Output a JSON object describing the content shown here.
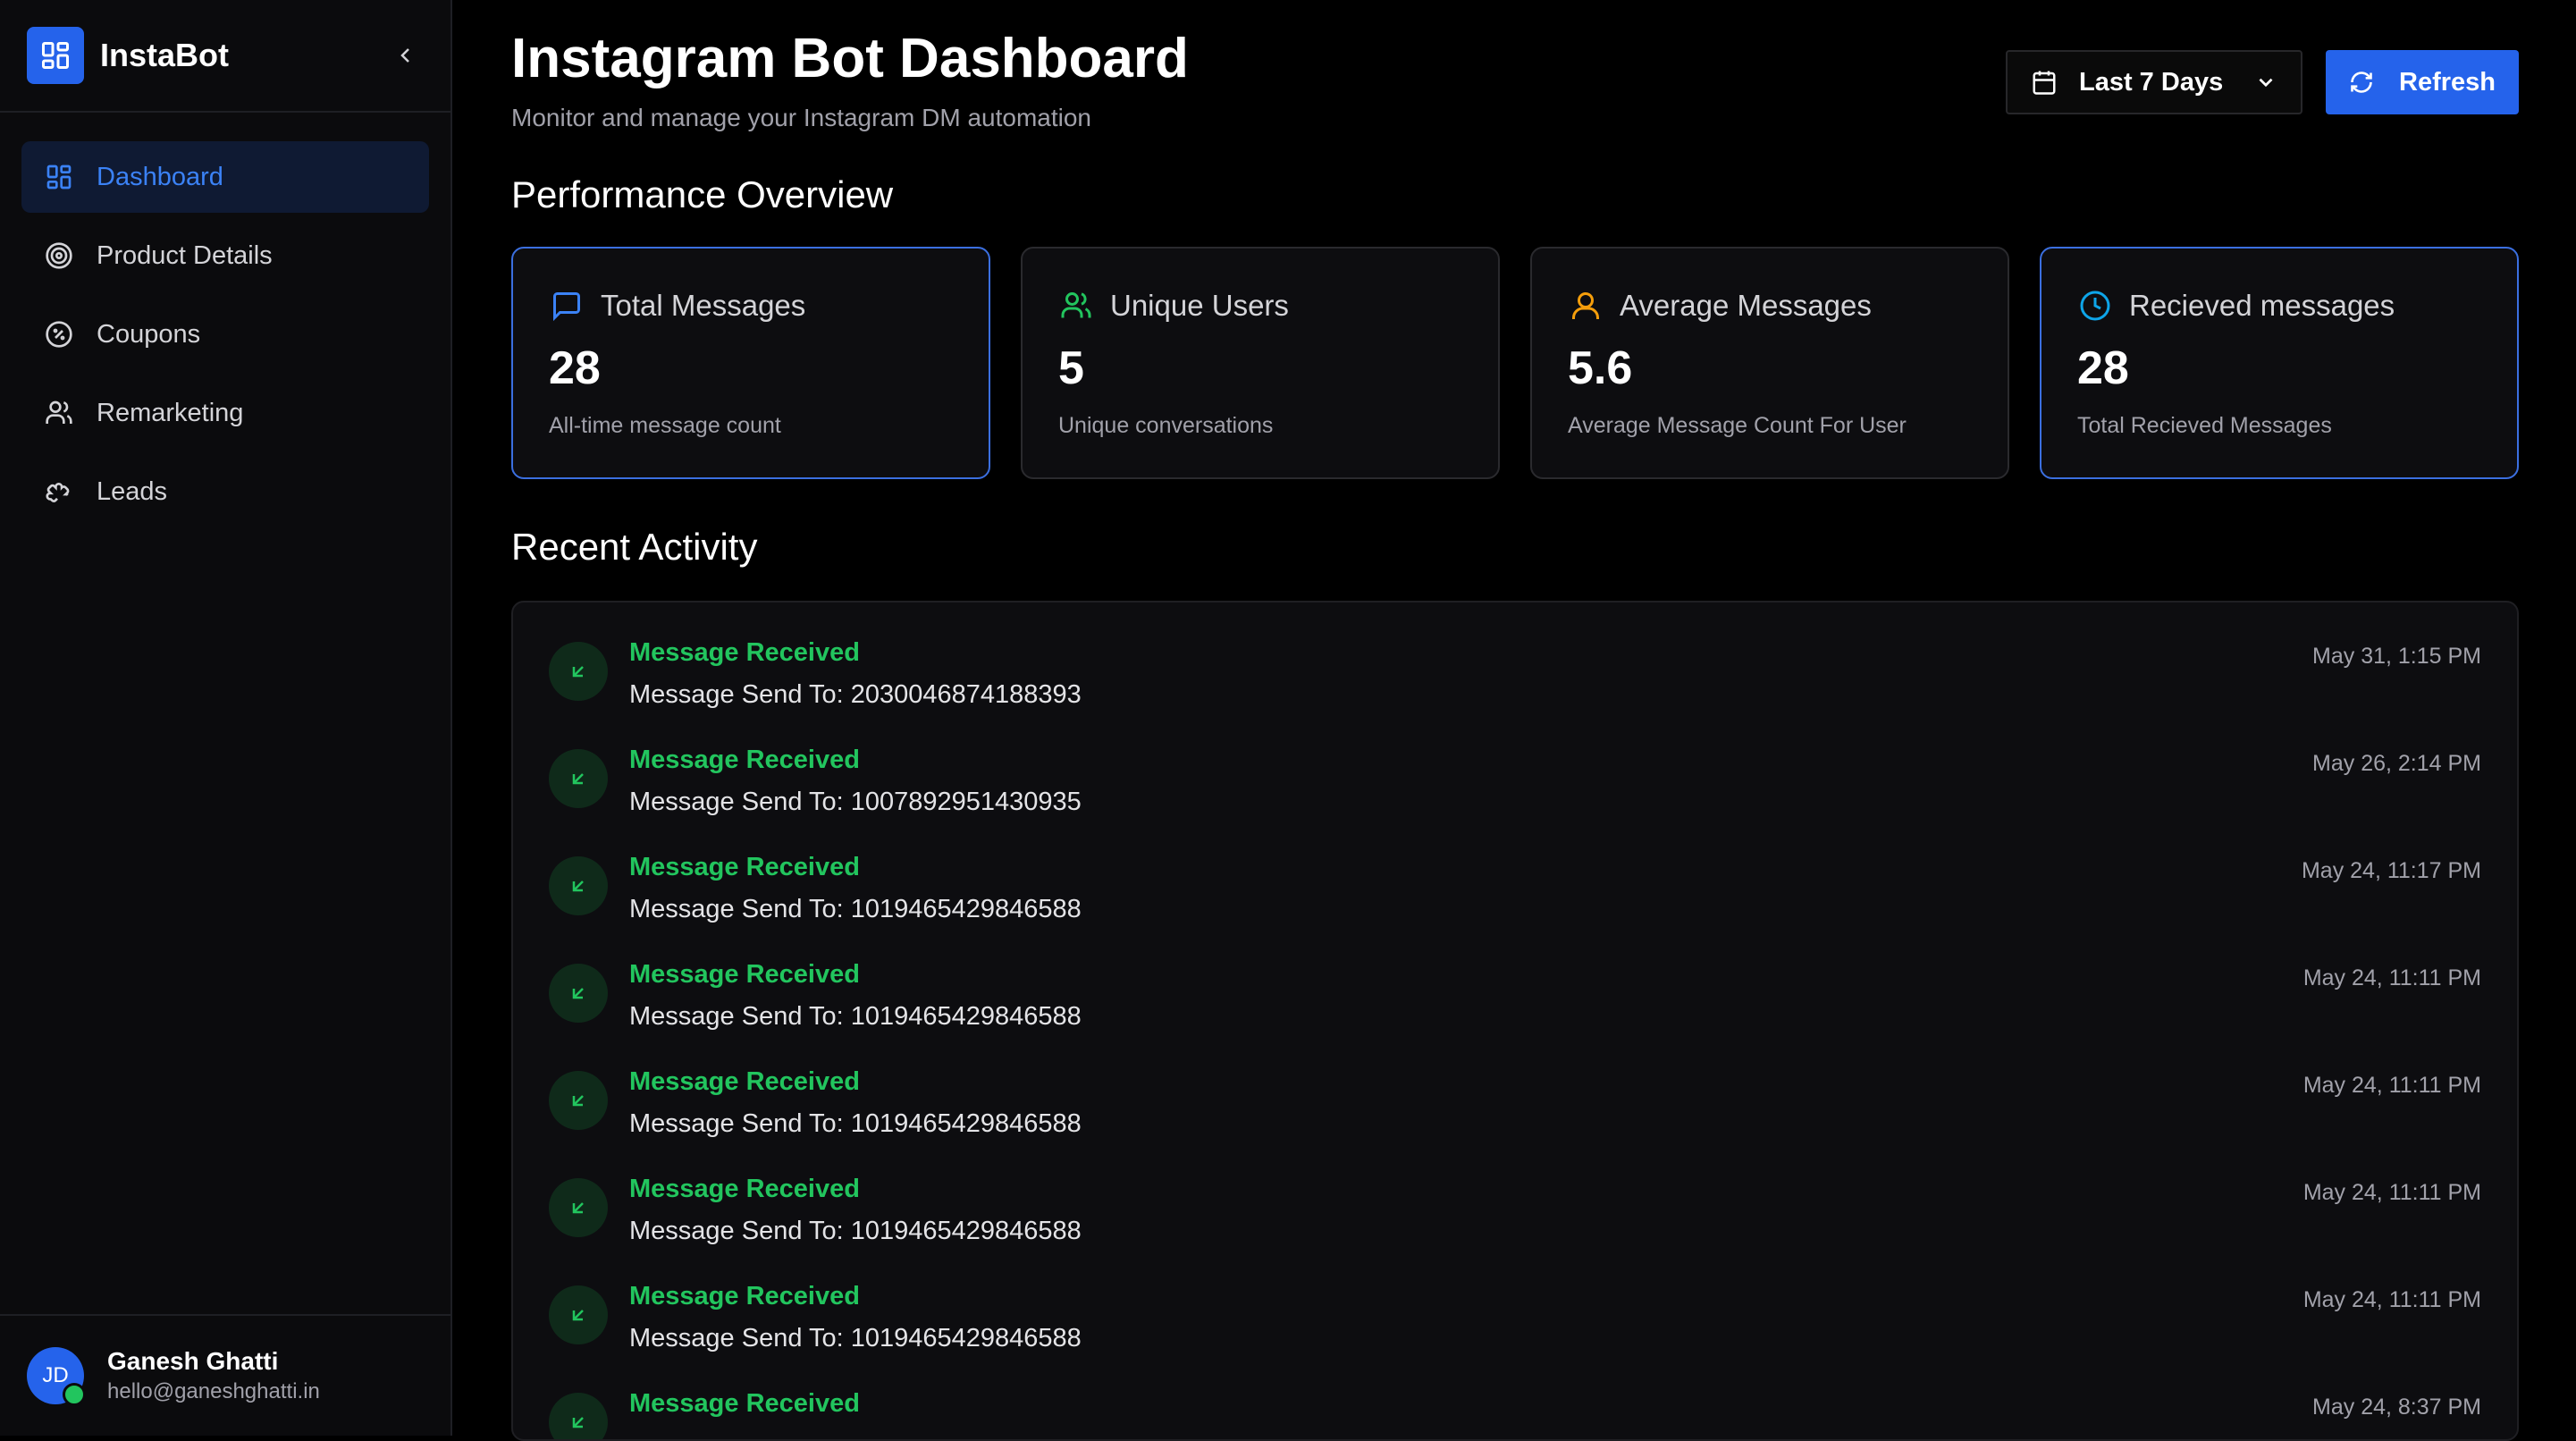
{
  "app": {
    "name": "InstaBot"
  },
  "colors": {
    "accent": "#2563eb",
    "success": "#22c55e",
    "warning": "#f59e0b",
    "info": "#0ea5e9"
  },
  "sidebar": {
    "items": [
      {
        "label": "Dashboard",
        "icon": "grid-icon",
        "active": true
      },
      {
        "label": "Product Details",
        "icon": "target-icon"
      },
      {
        "label": "Coupons",
        "icon": "percent-badge-icon"
      },
      {
        "label": "Remarketing",
        "icon": "users-icon"
      },
      {
        "label": "Leads",
        "icon": "puzzle-icon"
      }
    ]
  },
  "user": {
    "initials": "JD",
    "name": "Ganesh Ghatti",
    "email": "hello@ganeshghatti.in"
  },
  "header": {
    "title": "Instagram Bot Dashboard",
    "subtitle": "Monitor and manage your Instagram DM automation",
    "range": "Last 7 Days",
    "refresh": "Refresh"
  },
  "performance": {
    "title": "Performance Overview",
    "cards": [
      {
        "title": "Total Messages",
        "value": "28",
        "desc": "All-time message count",
        "icon": "message-icon"
      },
      {
        "title": "Unique Users",
        "value": "5",
        "desc": "Unique conversations",
        "icon": "users-icon"
      },
      {
        "title": "Average Messages",
        "value": "5.6",
        "desc": "Average Message Count For User",
        "icon": "user-icon"
      },
      {
        "title": "Recieved messages",
        "value": "28",
        "desc": "Total Recieved Messages",
        "icon": "clock-icon"
      }
    ]
  },
  "recent": {
    "title": "Recent Activity",
    "items": [
      {
        "title": "Message Received",
        "text": "Message Send To: 2030046874188393",
        "time": "May 31, 1:15 PM"
      },
      {
        "title": "Message Received",
        "text": "Message Send To: 1007892951430935",
        "time": "May 26, 2:14 PM"
      },
      {
        "title": "Message Received",
        "text": "Message Send To: 1019465429846588",
        "time": "May 24, 11:17 PM"
      },
      {
        "title": "Message Received",
        "text": "Message Send To: 1019465429846588",
        "time": "May 24, 11:11 PM"
      },
      {
        "title": "Message Received",
        "text": "Message Send To: 1019465429846588",
        "time": "May 24, 11:11 PM"
      },
      {
        "title": "Message Received",
        "text": "Message Send To: 1019465429846588",
        "time": "May 24, 11:11 PM"
      },
      {
        "title": "Message Received",
        "text": "Message Send To: 1019465429846588",
        "time": "May 24, 11:11 PM"
      },
      {
        "title": "Message Received",
        "text": "",
        "time": "May 24, 8:37 PM"
      }
    ]
  }
}
